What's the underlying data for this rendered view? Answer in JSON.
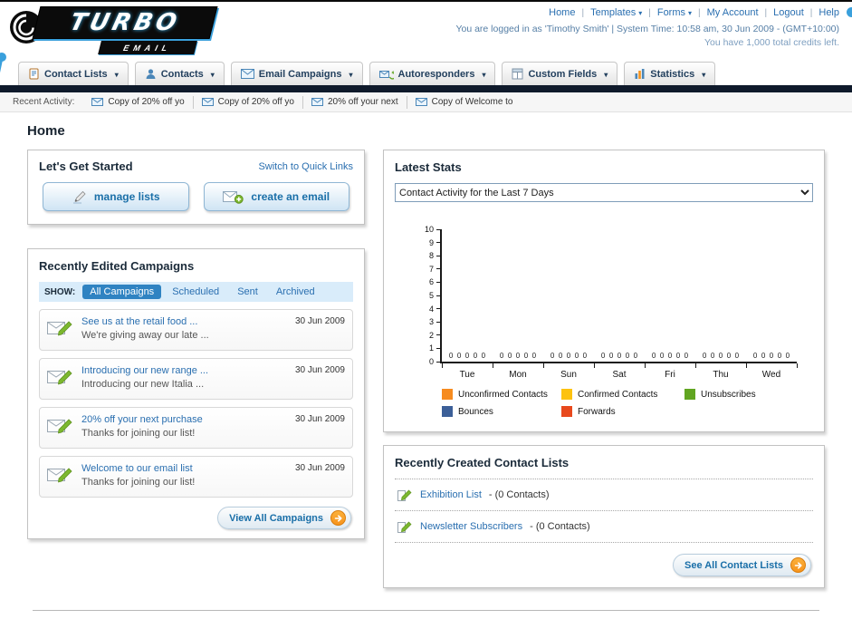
{
  "page_title": "Home",
  "header": {
    "logo_line1": "TURBO",
    "logo_line2": "EMAIL",
    "top_nav": [
      {
        "label": "Home"
      },
      {
        "label": "Templates"
      },
      {
        "label": "Forms"
      },
      {
        "label": "My Account"
      },
      {
        "label": "Logout"
      },
      {
        "label": "Help"
      }
    ],
    "login_line": "You are logged in as 'Timothy Smith' | System Time: 10:58 am, 30 Jun 2009 - (GMT+10:00)",
    "credits_line": "You have 1,000 total credits left."
  },
  "main_nav": [
    {
      "label": "Contact Lists"
    },
    {
      "label": "Contacts"
    },
    {
      "label": "Email Campaigns"
    },
    {
      "label": "Autoresponders"
    },
    {
      "label": "Custom Fields"
    },
    {
      "label": "Statistics"
    }
  ],
  "recent_activity": {
    "label": "Recent Activity:",
    "items": [
      {
        "label": "Copy of 20% off yo"
      },
      {
        "label": "Copy of 20% off yo"
      },
      {
        "label": "20% off your next"
      },
      {
        "label": "Copy of Welcome to"
      }
    ]
  },
  "get_started": {
    "title": "Let's Get Started",
    "switch_link": "Switch to Quick Links",
    "manage_lists_label": "manage lists",
    "create_email_label": "create an email"
  },
  "campaigns": {
    "title": "Recently Edited Campaigns",
    "show_label": "SHOW:",
    "tabs": [
      {
        "label": "All Campaigns"
      },
      {
        "label": "Scheduled"
      },
      {
        "label": "Sent"
      },
      {
        "label": "Archived"
      }
    ],
    "items": [
      {
        "title": "See us at the retail food ...",
        "subtitle": "We're giving away our late ...",
        "date": "30 Jun 2009"
      },
      {
        "title": "Introducing our new range ...",
        "subtitle": "Introducing our new Italia ...",
        "date": "30 Jun 2009"
      },
      {
        "title": "20% off your next purchase",
        "subtitle": "Thanks for joining our list!",
        "date": "30 Jun 2009"
      },
      {
        "title": "Welcome to our email list",
        "subtitle": "Thanks for joining our list!",
        "date": "30 Jun 2009"
      }
    ],
    "view_all_label": "View All Campaigns"
  },
  "stats": {
    "title": "Latest Stats",
    "range_selected": "Contact Activity for the Last 7 Days"
  },
  "chart_data": {
    "type": "bar",
    "title": "Contact Activity for the Last 7 Days",
    "categories": [
      "Tue",
      "Mon",
      "Sun",
      "Sat",
      "Fri",
      "Thu",
      "Wed"
    ],
    "series": [
      {
        "name": "Unconfirmed Contacts",
        "color": "#f68b1f",
        "values": [
          0,
          0,
          0,
          0,
          0,
          0,
          0
        ]
      },
      {
        "name": "Confirmed Contacts",
        "color": "#fdc20f",
        "values": [
          0,
          0,
          0,
          0,
          0,
          0,
          0
        ]
      },
      {
        "name": "Unsubscribes",
        "color": "#61a521",
        "values": [
          0,
          0,
          0,
          0,
          0,
          0,
          0
        ]
      },
      {
        "name": "Bounces",
        "color": "#3c5f98",
        "values": [
          0,
          0,
          0,
          0,
          0,
          0,
          0
        ]
      },
      {
        "name": "Forwards",
        "color": "#e8491d",
        "values": [
          0,
          0,
          0,
          0,
          0,
          0,
          0
        ]
      }
    ],
    "ylim": [
      0,
      10
    ],
    "ytick_step": 1,
    "grid": false,
    "legend_position": "bottom",
    "xlabel": "",
    "ylabel": ""
  },
  "contact_lists": {
    "title": "Recently Created Contact Lists",
    "items": [
      {
        "name": "Exhibition List",
        "contacts": "- (0 Contacts)"
      },
      {
        "name": "Newsletter Subscribers",
        "contacts": "- (0 Contacts)"
      }
    ],
    "see_all_label": "See All Contact Lists"
  }
}
